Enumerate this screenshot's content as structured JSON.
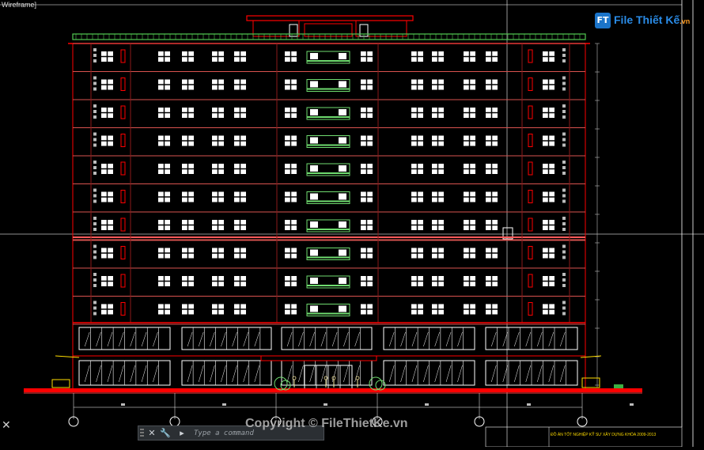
{
  "viewport": {
    "label": "Wireframe]"
  },
  "logo": {
    "mark": "FT",
    "text": "File Thiết Kế",
    "tld": ".vn"
  },
  "command_line": {
    "close_icon": "✕",
    "settings_icon": "🔧",
    "recent_icon": "▸",
    "placeholder": "Type a command"
  },
  "watermark": "Copyright © FileThietKe.vn",
  "title_block": {
    "project_text": "ĐỒ ÁN TỐT NGHIỆP KỸ SƯ XÂY DỰNG KHÓA 2009-2013"
  },
  "building": {
    "typical_floors": 10,
    "commercial_floors": 2,
    "axis_count": 6
  },
  "colors": {
    "background": "#000000",
    "outline": "#ff0000",
    "floor_line": "#d9534f",
    "windows": "#ffffff",
    "balcony": "#6fdc6f",
    "roof_rail": "#52c952",
    "annotation": "#ffdd00",
    "accent_blue": "#1b74c9"
  }
}
